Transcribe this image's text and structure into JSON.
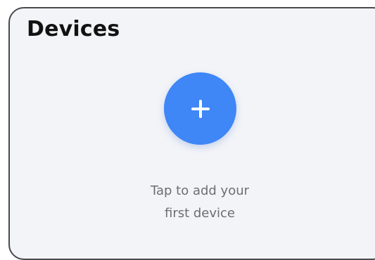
{
  "card": {
    "title": "Devices",
    "add_button": {
      "icon": "plus-icon"
    },
    "empty_state": {
      "line1": "Tap to add your",
      "line2": "first device"
    }
  },
  "colors": {
    "accent": "#3f86f6",
    "card_bg": "#f3f4f8",
    "title": "#121212",
    "muted_text": "#6e6e72"
  }
}
